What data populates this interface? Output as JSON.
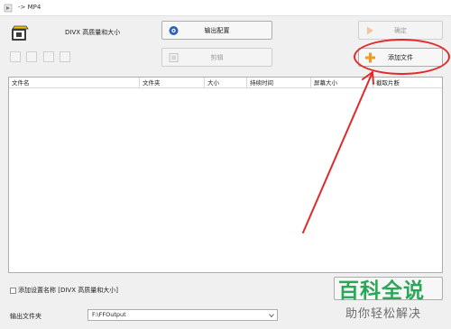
{
  "window": {
    "title": "-> MP4"
  },
  "profile": {
    "label": "DIVX 高质量和大小"
  },
  "buttons": {
    "output_config": "输出配置",
    "ok": "确定",
    "clip": "剪辑",
    "add_file": "添加文件"
  },
  "table": {
    "columns": [
      "文件名",
      "文件夹",
      "大小",
      "持续时间",
      "屏幕大小",
      "截取片断"
    ]
  },
  "options": {
    "add_setting_name": "添加设置名称 [DIVX 高质量和大小]"
  },
  "output": {
    "label": "输出文件夹",
    "path": "F:\\FFOutput"
  },
  "watermark": {
    "brand": "百科全说",
    "tagline": "助你轻松解决"
  },
  "colors": {
    "annotation_red": "#e2292a",
    "watermark_green": "#2aa85a",
    "add_icon_orange": "#f29a1d"
  },
  "icons": {
    "app": "format-factory-icon",
    "profile": "video-film-icon",
    "output_config": "settings-disc-icon",
    "ok": "arrow-right-icon",
    "clip": "scissors-film-icon",
    "add_file": "plus-icon"
  }
}
